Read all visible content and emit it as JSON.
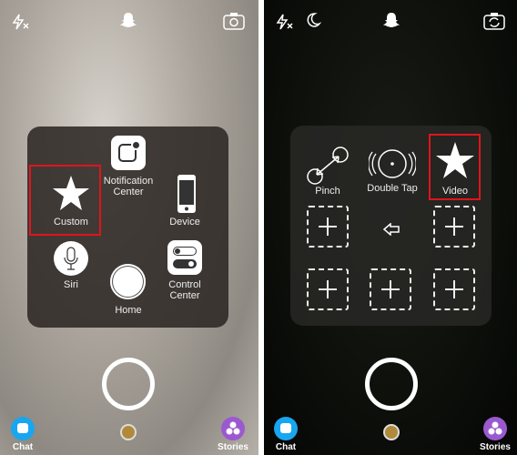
{
  "left": {
    "menu": {
      "notification_center": "Notification\nCenter",
      "custom": "Custom",
      "device": "Device",
      "siri": "Siri",
      "home": "Home",
      "control_center": "Control\nCenter"
    },
    "chat": "Chat",
    "stories": "Stories"
  },
  "right": {
    "menu": {
      "pinch": "Pinch",
      "double_tap": "Double Tap",
      "video": "Video"
    },
    "chat": "Chat",
    "stories": "Stories"
  },
  "colors": {
    "highlight": "#e0141c",
    "chat": "#19a6f0",
    "stories": "#9b59d0"
  }
}
